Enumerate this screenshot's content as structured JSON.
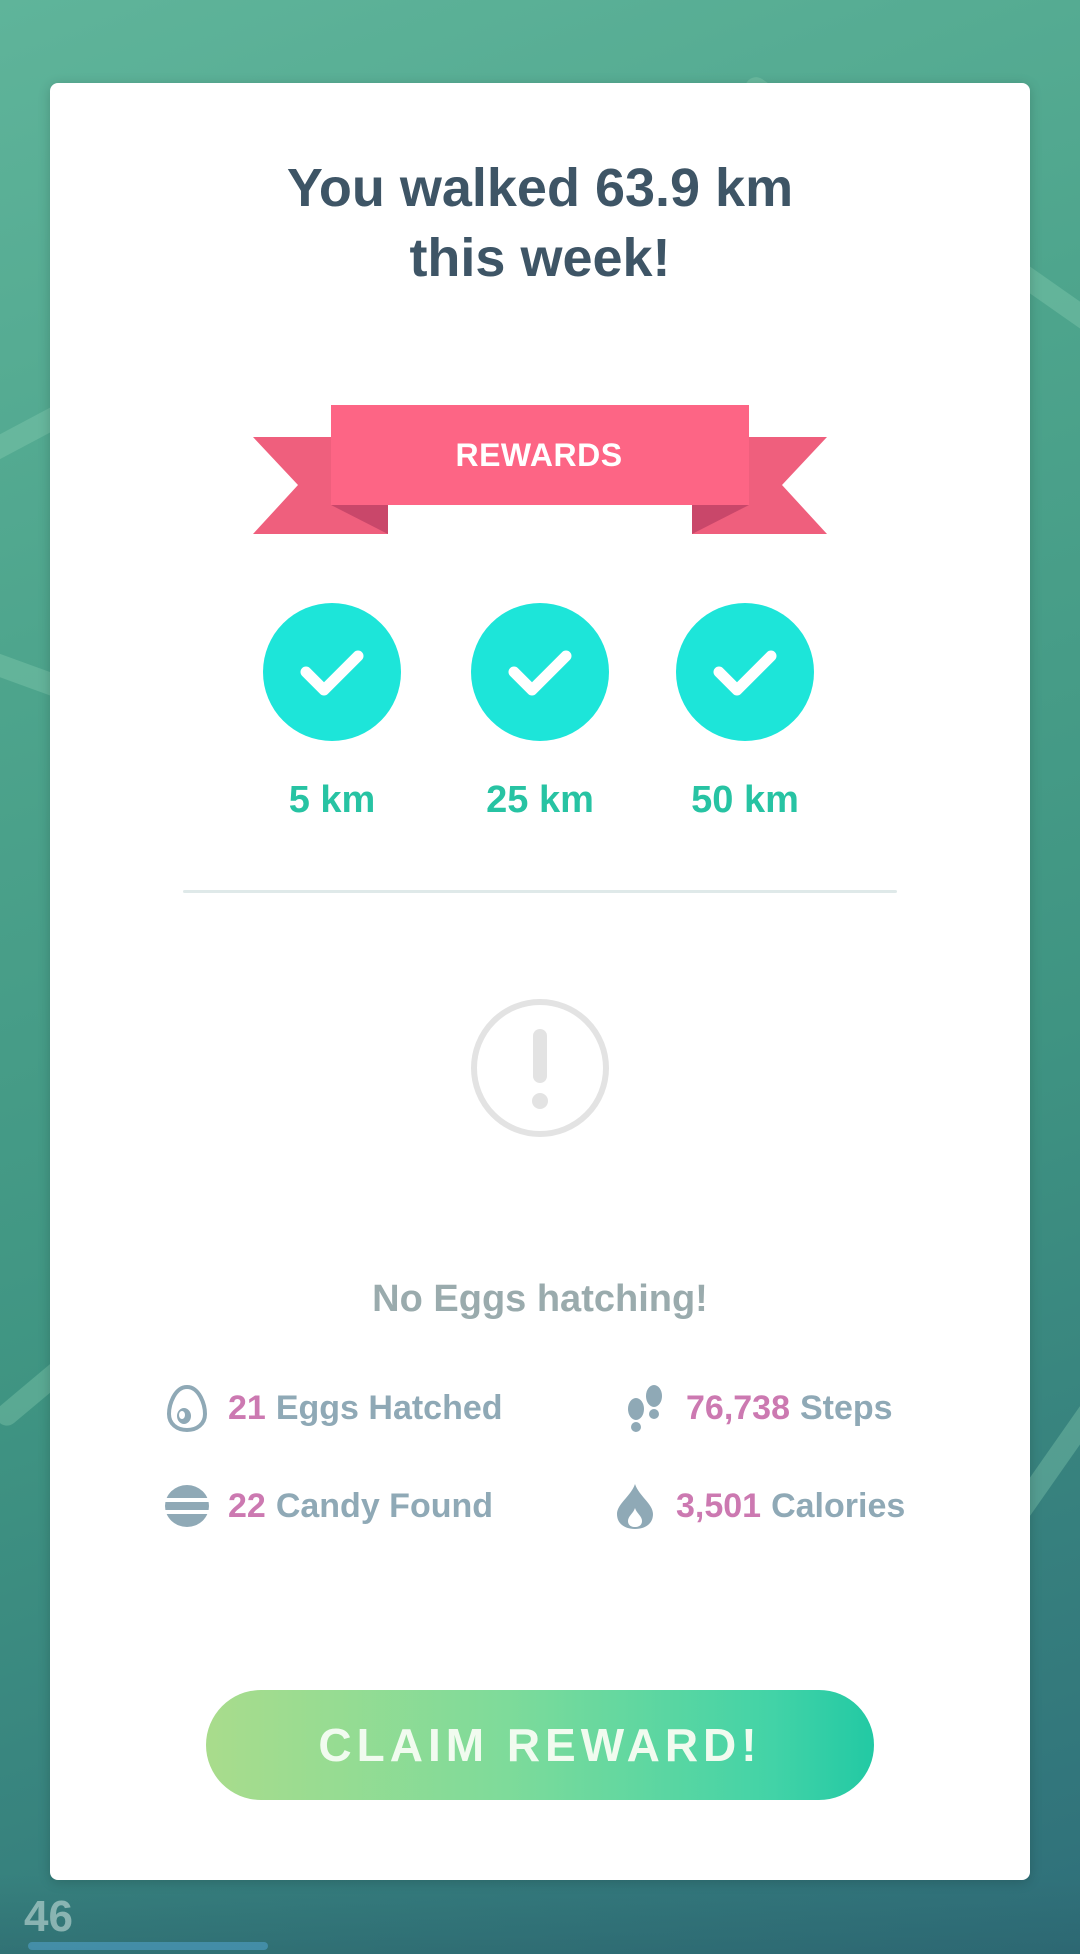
{
  "app": {
    "level": "46"
  },
  "card": {
    "title_line1": "You walked 63.9 km",
    "title_line2": "this week!",
    "rewards_label": "REWARDS"
  },
  "milestones": [
    {
      "label": "5 km",
      "completed": true
    },
    {
      "label": "25 km",
      "completed": true
    },
    {
      "label": "50 km",
      "completed": true
    }
  ],
  "eggs_status": "No Eggs hatching!",
  "stats": {
    "eggs": {
      "value": "21",
      "label": "Eggs Hatched",
      "icon": "egg-icon"
    },
    "steps": {
      "value": "76,738",
      "label": "Steps",
      "icon": "footsteps-icon"
    },
    "candy": {
      "value": "22",
      "label": "Candy Found",
      "icon": "candy-icon"
    },
    "calories": {
      "value": "3,501",
      "label": "Calories",
      "icon": "flame-icon"
    }
  },
  "claim_button": {
    "label": "CLAIM REWARD!"
  },
  "colors": {
    "ribbon": "#fd6585",
    "ribbon_tail": "#ef5f7d",
    "check_circle": "#1de5d9",
    "milestone_text": "#27c3a3",
    "title_text": "#3e5566",
    "stat_number": "#cc79b1",
    "stat_label": "#8fa9b6"
  }
}
